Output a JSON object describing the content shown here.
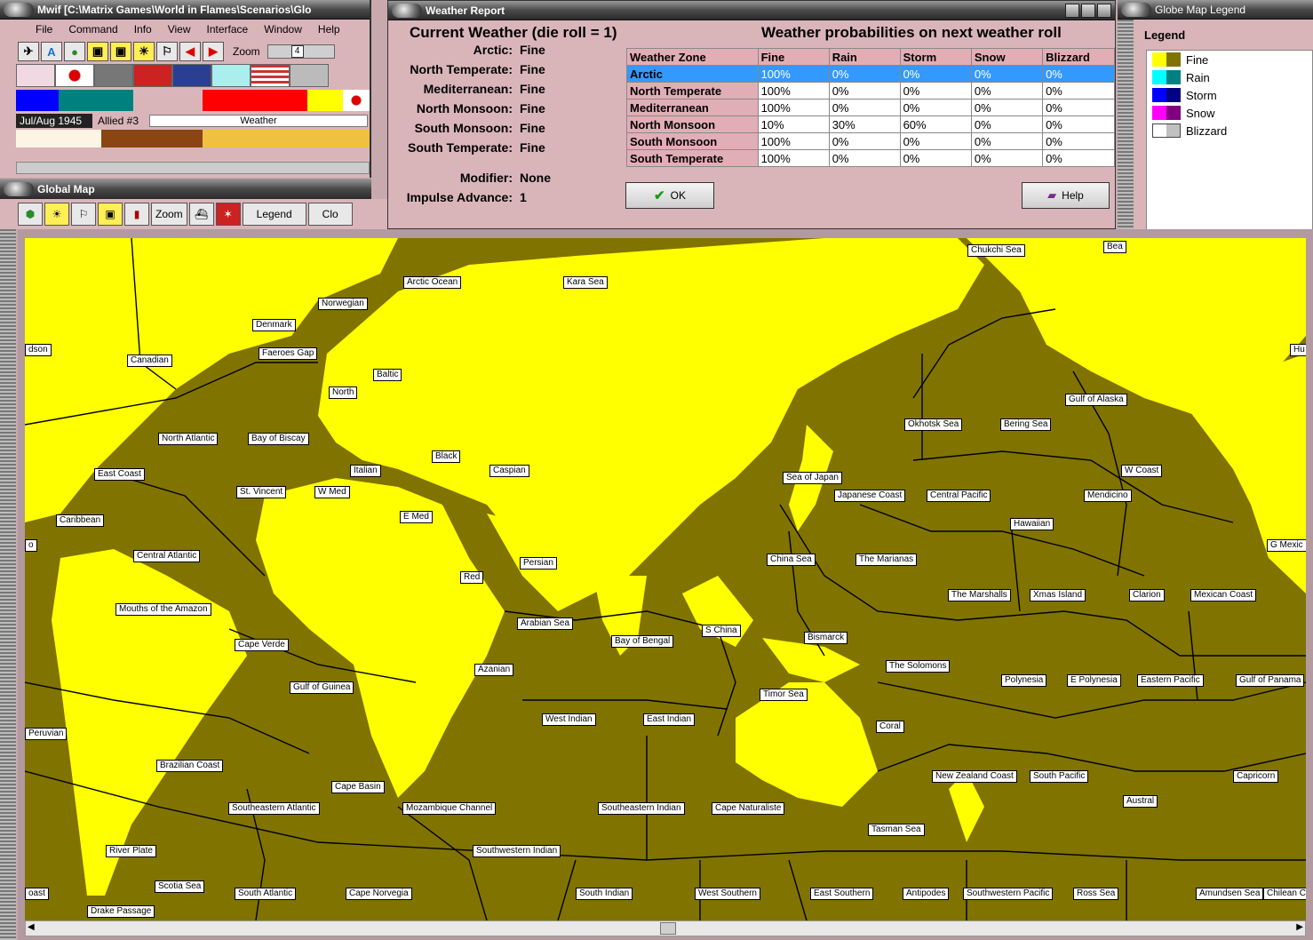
{
  "main_window": {
    "title": "Mwif [C:\\Matrix Games\\World in Flames\\Scenarios\\Glo",
    "menu": [
      "File",
      "Command",
      "Info",
      "View",
      "Interface",
      "Window",
      "Help"
    ],
    "zoom_label": "Zoom",
    "zoom_value": "4",
    "date": "Jul/Aug 1945",
    "turn": "Allied #3",
    "mode": "Weather"
  },
  "global_map": {
    "title": "Global Map",
    "zoom_button": "Zoom",
    "legend_button": "Legend",
    "close_button": "Clo"
  },
  "weather_report": {
    "title": "Weather Report",
    "current_heading": "Current Weather (die roll = 1)",
    "prob_heading": "Weather probabilities on next weather roll",
    "zones": [
      {
        "label": "Arctic:",
        "value": "Fine"
      },
      {
        "label": "North Temperate:",
        "value": "Fine"
      },
      {
        "label": "Mediterranean:",
        "value": "Fine"
      },
      {
        "label": "North Monsoon:",
        "value": "Fine"
      },
      {
        "label": "South Monsoon:",
        "value": "Fine"
      },
      {
        "label": "South Temperate:",
        "value": "Fine"
      }
    ],
    "modifier_label": "Modifier:",
    "modifier_value": "None",
    "impulse_label": "Impulse Advance:",
    "impulse_value": "1",
    "table_headers": [
      "Weather Zone",
      "Fine",
      "Rain",
      "Storm",
      "Snow",
      "Blizzard"
    ],
    "table_rows": [
      {
        "zone": "Arctic",
        "fine": "100%",
        "rain": "0%",
        "storm": "0%",
        "snow": "0%",
        "blizzard": "0%"
      },
      {
        "zone": "North Temperate",
        "fine": "100%",
        "rain": "0%",
        "storm": "0%",
        "snow": "0%",
        "blizzard": "0%"
      },
      {
        "zone": "Mediterranean",
        "fine": "100%",
        "rain": "0%",
        "storm": "0%",
        "snow": "0%",
        "blizzard": "0%"
      },
      {
        "zone": "North Monsoon",
        "fine": "10%",
        "rain": "30%",
        "storm": "60%",
        "snow": "0%",
        "blizzard": "0%"
      },
      {
        "zone": "South Monsoon",
        "fine": "100%",
        "rain": "0%",
        "storm": "0%",
        "snow": "0%",
        "blizzard": "0%"
      },
      {
        "zone": "South Temperate",
        "fine": "100%",
        "rain": "0%",
        "storm": "0%",
        "snow": "0%",
        "blizzard": "0%"
      }
    ],
    "ok_button": "OK",
    "help_button": "Help"
  },
  "legend_window": {
    "title": "Globe Map Legend",
    "heading": "Legend",
    "items": [
      {
        "label": "Fine",
        "c1": "#ffff00",
        "c2": "#807300"
      },
      {
        "label": "Rain",
        "c1": "#00ffff",
        "c2": "#008080"
      },
      {
        "label": "Storm",
        "c1": "#0000ff",
        "c2": "#000080"
      },
      {
        "label": "Snow",
        "c1": "#ff00ff",
        "c2": "#800080"
      },
      {
        "label": "Blizzard",
        "c1": "#ffffff",
        "c2": "#c0c0c0"
      }
    ]
  },
  "sea_areas": [
    "Arctic Ocean",
    "Kara Sea",
    "Chukchi Sea",
    "Bea",
    "Norwegian",
    "Denmark",
    "dson",
    "Canadian",
    "Faeroes Gap",
    "Baltic",
    "North",
    "North Atlantic",
    "Bay of Biscay",
    "Black",
    "East Coast",
    "Italian",
    "Caspian",
    "St. Vincent",
    "W Med",
    "Caribbean",
    "E Med",
    "Central Atlantic",
    "Persian",
    "Red",
    "Mouths of the Amazon",
    "Arabian Sea",
    "Cape Verde",
    "Azanian",
    "Bay of Bengal",
    "S China",
    "Gulf of Guinea",
    "West Indian",
    "East Indian",
    "Peruvian",
    "Brazilian Coast",
    "Cape Basin",
    "Southeastern Atlantic",
    "Mozambique Channel",
    "Southeastern Indian",
    "Cape Naturaliste",
    "River Plate",
    "Southwestern Indian",
    "Scotia Sea",
    "South Atlantic",
    "Cape Norvegia",
    "South Indian",
    "West Southern",
    "East Southern",
    "Antipodes",
    "Southwestern Pacific",
    "Ross Sea",
    "Amundsen Sea",
    "Chilean C",
    "Drake Passage",
    "oast",
    "Okhotsk Sea",
    "Bering Sea",
    "Gulf of Alaska",
    "Hu",
    "W Coast",
    "Sea of Japan",
    "Japanese Coast",
    "Central Pacific",
    "Mendicino",
    "Hawaiian",
    "G Mexic",
    "China Sea",
    "The Marianas",
    "The Marshalls",
    "Xmas Island",
    "Clarion",
    "Mexican Coast",
    "Bismarck",
    "The Solomons",
    "Polynesia",
    "E Polynesia",
    "Eastern Pacific",
    "Gulf of Panama",
    "Timor Sea",
    "Coral",
    "New Zealand Coast",
    "South Pacific",
    "Capricorn",
    "Austral",
    "Tasman Sea",
    "o"
  ],
  "colors": {
    "fine_land": "#ffff00",
    "fine_sea": "#807300",
    "window_bg": "#d9b5ba"
  }
}
